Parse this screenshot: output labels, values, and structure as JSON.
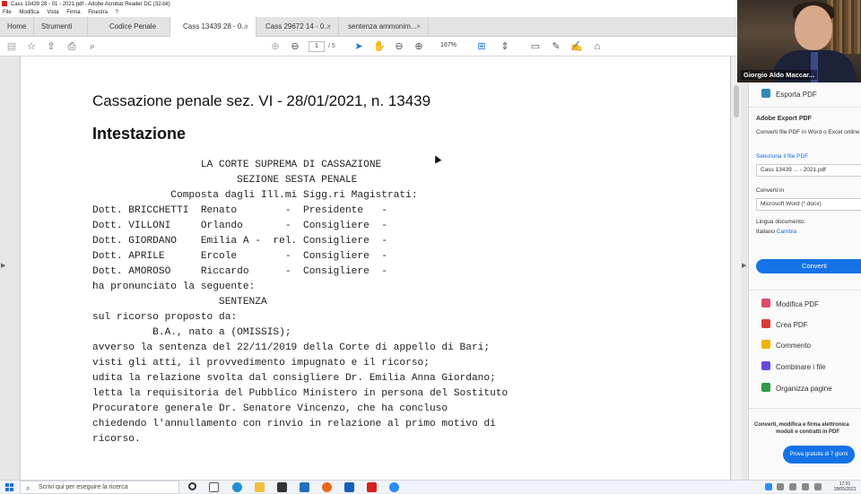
{
  "window": {
    "title": "Cass 13439 28 - 01 - 2021.pdf - Adobe Acrobat Reader DC (32-bit)"
  },
  "menu": [
    "File",
    "Modifica",
    "Vista",
    "Firma",
    "Finestra",
    "?"
  ],
  "tabs": [
    {
      "label": "Home"
    },
    {
      "label": "Strumenti"
    },
    {
      "label": "Codice Penale"
    },
    {
      "label": "Cass 13439 28 - 0...",
      "active": true
    },
    {
      "label": "Cass 29672 14 - 0..."
    },
    {
      "label": "sentenza ammonim..."
    }
  ],
  "toolbar": {
    "page_current": "1",
    "page_total": "/ 5",
    "zoom": "167%"
  },
  "document": {
    "title": "Cassazione penale sez. VI - 28/01/2021, n. 13439",
    "heading": "Intestazione",
    "lines": [
      "                  LA CORTE SUPREMA DI CASSAZIONE",
      "                        SEZIONE SESTA PENALE",
      "             Composta dagli Ill.mi Sigg.ri Magistrati:",
      "Dott. BRICCHETTI  Renato        -  Presidente   -",
      "Dott. VILLONI     Orlando       -  Consigliere  -",
      "Dott. GIORDANO    Emilia A -  rel. Consigliere  -",
      "Dott. APRILE      Ercole        -  Consigliere  -",
      "Dott. AMOROSO     Riccardo      -  Consigliere  -",
      "ha pronunciato la seguente:",
      "                     SENTENZA",
      "sul ricorso proposto da:",
      "          B.A., nato a (OMISSIS);",
      "avverso la sentenza del 22/11/2019 della Corte di appello di Bari;",
      "visti gli atti, il provvedimento impugnato e il ricorso;",
      "udita la relazione svolta dal consigliere Dr. Emilia Anna Giordano;",
      "letta la requisitoria del Pubblico Ministero in persona del Sostituto",
      "Procuratore generale Dr. Senatore Vincenzo, che ha concluso",
      "chiedendo l'annullamento con rinvio in relazione al primo motivo di",
      "ricorso."
    ]
  },
  "webcam": {
    "name": "Giorgio Aldo Maccar..."
  },
  "rightpanel": {
    "export_pdf": "Esporta PDF",
    "export_title": "Adobe Export PDF",
    "export_desc": "Converti file PDF in Word o Excel online",
    "select_file_label": "Seleziona il file PDF",
    "selected_file": "Cass 13439 ... - 2021.pdf",
    "convert_in_label": "Converti in",
    "convert_format": "Microsoft Word (*.docx)",
    "language_label": "Lingua documento:",
    "language_value": "Italiano",
    "language_change": "Cambia",
    "convert_button": "Converti",
    "tools": [
      {
        "label": "Modifica PDF",
        "color": "#e04a6a"
      },
      {
        "label": "Crea PDF",
        "color": "#d93a3a"
      },
      {
        "label": "Commento",
        "color": "#f0b400"
      },
      {
        "label": "Combinare i file",
        "color": "#6a4adf"
      },
      {
        "label": "Organizza pagine",
        "color": "#2e9a4a"
      }
    ],
    "promo_line1": "Converti, modifica e firma elettronica",
    "promo_line2": "moduli e contratti in PDF",
    "promo_button": "Prova gratuita di 7 giorni"
  },
  "taskbar": {
    "search_placeholder": "Scrivi qui per eseguire la ricerca",
    "time": "17:31",
    "date": "18/05/2021"
  }
}
